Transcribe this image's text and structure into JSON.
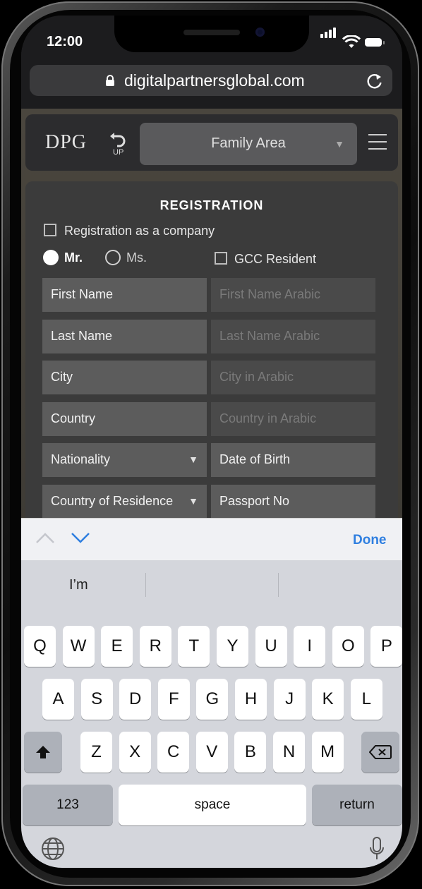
{
  "status": {
    "time": "12:00"
  },
  "browser": {
    "url": "digitalpartnersglobal.com"
  },
  "header": {
    "logo": "DPG",
    "up_label": "UP",
    "dropdown_value": "Family Area"
  },
  "form": {
    "title": "REGISTRATION",
    "company_label": "Registration as a company",
    "title_options": [
      "Mr.",
      "Ms."
    ],
    "selected_title": "Mr.",
    "gcc_label": "GCC Resident",
    "fields_left": [
      "First Name",
      "Last Name",
      "City",
      "Country",
      "Nationality",
      "Country of Residence"
    ],
    "fields_right": [
      "First Name Arabic",
      "Last Name Arabic",
      "City in Arabic",
      "Country in Arabic",
      "Date of Birth",
      "Passport No"
    ]
  },
  "keyboard": {
    "done_label": "Done",
    "suggestions": [
      "I’m",
      "",
      ""
    ],
    "row1": [
      "Q",
      "W",
      "E",
      "R",
      "T",
      "Y",
      "U",
      "I",
      "O",
      "P"
    ],
    "row2": [
      "A",
      "S",
      "D",
      "F",
      "G",
      "H",
      "J",
      "K",
      "L"
    ],
    "row3": [
      "Z",
      "X",
      "C",
      "V",
      "B",
      "N",
      "M"
    ],
    "numbers_label": "123",
    "space_label": "space",
    "return_label": "return"
  },
  "colors": {
    "accent": "#2f7fe0",
    "field_bg": "#5c5c5c",
    "panel_bg": "#3b3b3b"
  }
}
